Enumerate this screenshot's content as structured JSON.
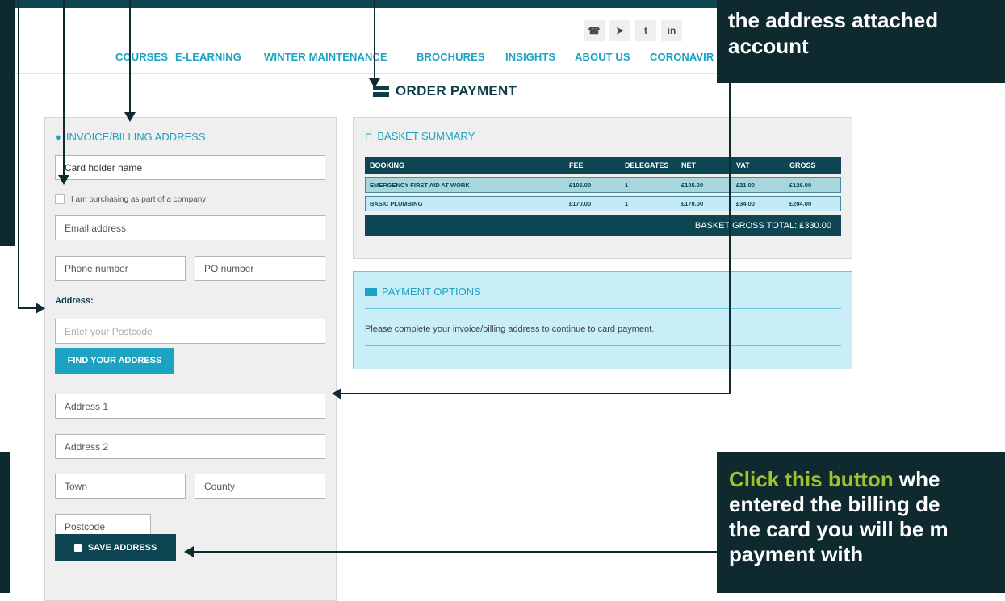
{
  "social": [
    "phone-icon",
    "send-icon",
    "twitter-icon",
    "linkedin-icon"
  ],
  "nav": {
    "items": [
      "COURSES",
      "E-LEARNING",
      "WINTER MAINTENANCE",
      "BROCHURES",
      "INSIGHTS",
      "ABOUT US",
      "CORONAVIR"
    ]
  },
  "page": {
    "title": "ORDER PAYMENT"
  },
  "billing": {
    "heading": "INVOICE/BILLING ADDRESS",
    "card_holder_placeholder": "Card holder name",
    "company_checkbox_label": "I am purchasing as part of a company",
    "email_placeholder": "Email address",
    "phone_placeholder": "Phone number",
    "po_placeholder": "PO number",
    "address_label": "Address:",
    "postcode_search_placeholder": "Enter your Postcode",
    "find_button": "FIND YOUR ADDRESS",
    "address1_placeholder": "Address 1",
    "address2_placeholder": "Address 2",
    "town_placeholder": "Town",
    "county_placeholder": "County",
    "postcode_placeholder": "Postcode",
    "save_button": "SAVE ADDRESS"
  },
  "basket": {
    "heading": "BASKET SUMMARY",
    "columns": [
      "BOOKING",
      "FEE",
      "DELEGATES",
      "NET",
      "VAT",
      "GROSS"
    ],
    "rows": [
      [
        "EMERGENCY FIRST AID AT WORK",
        "£105.00",
        "1",
        "£105.00",
        "£21.00",
        "£126.00"
      ],
      [
        "BASIC PLUMBING",
        "£170.00",
        "1",
        "£170.00",
        "£34.00",
        "£204.00"
      ]
    ],
    "total": "BASKET GROSS TOTAL:  £330.00"
  },
  "payment": {
    "heading": "PAYMENT OPTIONS",
    "message": "Please complete your invoice/billing address to continue to card payment."
  },
  "callouts": {
    "top_right": [
      "the address attached",
      "account"
    ],
    "bottom_right_highlight": "Click this button",
    "bottom_right_rest": " whe",
    "bottom_right_lines": [
      "entered the billing de",
      "the card you will be m",
      "payment with"
    ]
  },
  "colors": {
    "dark_teal": "#0e4552",
    "accent_blue": "#1ca3c2",
    "callout_bg": "#0e2a2f",
    "highlight": "#9fc32b"
  }
}
